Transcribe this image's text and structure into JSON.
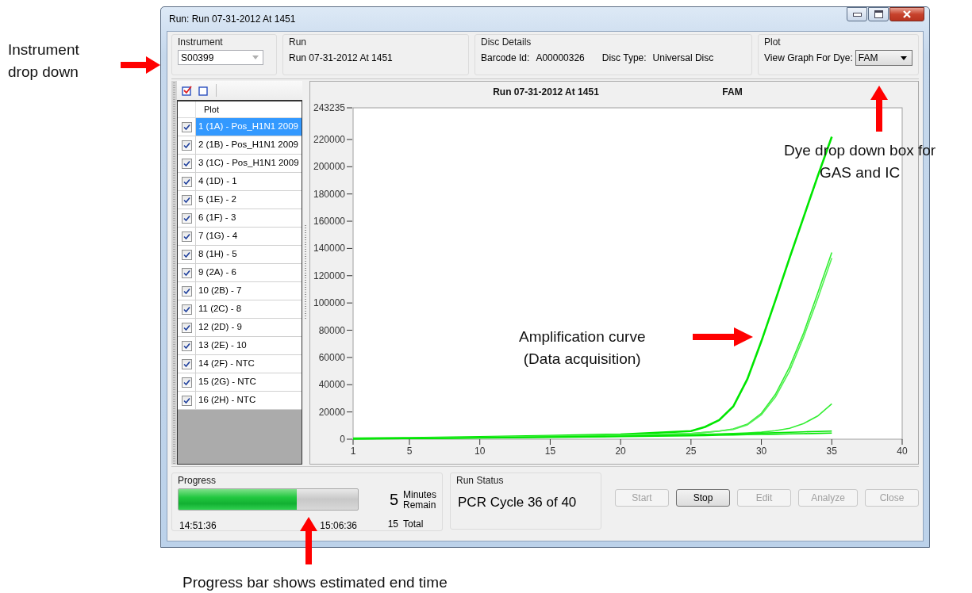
{
  "window": {
    "title": "Run: Run 07-31-2012 At 1451"
  },
  "instrument": {
    "label": "Instrument",
    "value": "S00399",
    "disabled": true
  },
  "run": {
    "label": "Run",
    "value": "Run 07-31-2012 At 1451"
  },
  "disc_details": {
    "label": "Disc Details",
    "fields": [
      {
        "label": "Barcode Id:",
        "value": "A00000326"
      },
      {
        "label": "Disc Type:",
        "value": "Universal Disc"
      }
    ]
  },
  "plot": {
    "label": "Plot",
    "field_label": "View Graph For Dye:",
    "value": "FAM"
  },
  "plot_list": {
    "column": "Plot",
    "items": [
      {
        "label": "1 (1A) - Pos_H1N1 2009",
        "checked": true,
        "selected": true
      },
      {
        "label": "2 (1B) - Pos_H1N1 2009",
        "checked": true,
        "selected": false
      },
      {
        "label": "3 (1C) - Pos_H1N1 2009",
        "checked": true,
        "selected": false
      },
      {
        "label": "4 (1D) - 1",
        "checked": true,
        "selected": false
      },
      {
        "label": "5 (1E) - 2",
        "checked": true,
        "selected": false
      },
      {
        "label": "6 (1F) - 3",
        "checked": true,
        "selected": false
      },
      {
        "label": "7 (1G) - 4",
        "checked": true,
        "selected": false
      },
      {
        "label": "8 (1H) - 5",
        "checked": true,
        "selected": false
      },
      {
        "label": "9 (2A) - 6",
        "checked": true,
        "selected": false
      },
      {
        "label": "10 (2B) - 7",
        "checked": true,
        "selected": false
      },
      {
        "label": "11 (2C) - 8",
        "checked": true,
        "selected": false
      },
      {
        "label": "12 (2D) - 9",
        "checked": true,
        "selected": false
      },
      {
        "label": "13 (2E) - 10",
        "checked": true,
        "selected": false
      },
      {
        "label": "14 (2F) - NTC",
        "checked": true,
        "selected": false
      },
      {
        "label": "15 (2G) - NTC",
        "checked": true,
        "selected": false
      },
      {
        "label": "16 (2H) - NTC",
        "checked": true,
        "selected": false
      }
    ]
  },
  "chart": {
    "dye": "FAM",
    "chart_data": {
      "type": "line",
      "title": "Run 07-31-2012 At 1451",
      "x": [
        1,
        5,
        10,
        15,
        20,
        25,
        26,
        27,
        28,
        29,
        30,
        31,
        32,
        33,
        34,
        35
      ],
      "xlim": [
        1,
        40
      ],
      "ylim": [
        0,
        243235
      ],
      "xticks": [
        1,
        5,
        10,
        15,
        20,
        25,
        30,
        35,
        40
      ],
      "yticks": [
        0,
        20000,
        40000,
        60000,
        80000,
        100000,
        120000,
        140000,
        160000,
        180000,
        200000,
        220000,
        243235
      ],
      "series": [
        {
          "color": "#00e600",
          "values": [
            500,
            800,
            1500,
            2500,
            3500,
            6000,
            9000,
            14000,
            24000,
            44000,
            72000,
            102000,
            133000,
            163000,
            193000,
            222000
          ]
        },
        {
          "color": "#33ee33",
          "values": [
            400,
            700,
            1300,
            2200,
            3000,
            4200,
            5000,
            6000,
            7500,
            11000,
            19000,
            33000,
            53000,
            78000,
            107000,
            137000
          ]
        },
        {
          "color": "#55f055",
          "values": [
            400,
            700,
            1300,
            2200,
            3000,
            4200,
            5000,
            6000,
            7200,
            10500,
            18000,
            31000,
            50000,
            75000,
            103000,
            133000
          ]
        },
        {
          "color": "#33ee33",
          "values": [
            300,
            600,
            1100,
            1800,
            2500,
            3300,
            3600,
            3900,
            4200,
            4600,
            5200,
            6200,
            8000,
            11500,
            17000,
            26000
          ]
        },
        {
          "color": "#00e600",
          "values": [
            300,
            600,
            1000,
            1600,
            2200,
            3000,
            3300,
            3600,
            3900,
            4200,
            4500,
            4800,
            5100,
            5400,
            5700,
            6000
          ]
        },
        {
          "color": "#00e600",
          "values": [
            300,
            500,
            900,
            1400,
            1900,
            2500,
            2700,
            2900,
            3100,
            3300,
            3500,
            3700,
            3900,
            4100,
            4300,
            4500
          ]
        }
      ]
    }
  },
  "progress": {
    "label": "Progress",
    "level": 0.66,
    "start_time": "14:51:36",
    "end_time": "15:06:36",
    "remain_value": "5",
    "remain_label": "Minutes\nRemain",
    "total_value": "15",
    "total_label": "Total"
  },
  "run_status": {
    "label": "Run Status",
    "text": "PCR Cycle 36 of 40"
  },
  "buttons": [
    {
      "label": "Start",
      "disabled": true
    },
    {
      "label": "Stop",
      "disabled": false
    },
    {
      "label": "Edit",
      "disabled": true
    },
    {
      "label": "Analyze",
      "disabled": true
    },
    {
      "label": "Close",
      "disabled": true
    }
  ],
  "annotations": [
    {
      "text": "Instrument\ndrop down"
    },
    {
      "text": "Dye drop down box for\nGAS and IC"
    },
    {
      "text": "Amplification curve\n(Data acquisition)"
    },
    {
      "text": "Progress bar shows estimated end time"
    }
  ]
}
